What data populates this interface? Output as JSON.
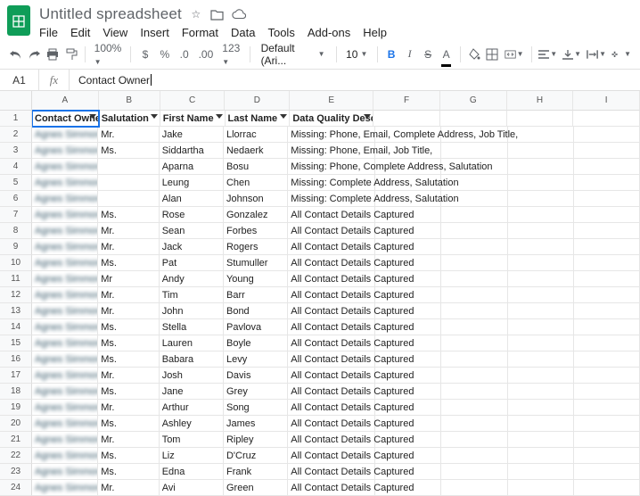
{
  "doc": {
    "title": "Untitled spreadsheet"
  },
  "menus": [
    "File",
    "Edit",
    "View",
    "Insert",
    "Format",
    "Data",
    "Tools",
    "Add-ons",
    "Help"
  ],
  "toolbar": {
    "zoom": "100%",
    "currency": "$",
    "percent": "%",
    "dec_dec": ".0",
    "dec_inc": ".00",
    "more_fmt": "123",
    "font": "Default (Ari...",
    "size": "10",
    "bold": "B",
    "italic": "I",
    "strike": "S",
    "textcolor": "A"
  },
  "fbar": {
    "cellref": "A1",
    "fx": "fx",
    "value": "Contact Owner"
  },
  "columns": [
    "A",
    "B",
    "C",
    "D",
    "E",
    "F",
    "G",
    "H",
    "I"
  ],
  "headers": {
    "A": "Contact Owner",
    "B": "Salutation",
    "C": "First Name",
    "D": "Last Name",
    "E": "Data Quality Description"
  },
  "rows": [
    {
      "n": 2,
      "owner": "Agnes Simmons",
      "sal": "Mr.",
      "first": "Jake",
      "last": "Llorrac",
      "dq": "Missing: Phone, Email, Complete Address, Job Title,"
    },
    {
      "n": 3,
      "owner": "Agnes Simmons",
      "sal": "Ms.",
      "first": "Siddartha",
      "last": "Nedaerk",
      "dq": "Missing: Phone, Email, Job Title,"
    },
    {
      "n": 4,
      "owner": "Agnes Simmons",
      "sal": "",
      "first": "Aparna",
      "last": "Bosu",
      "dq": "Missing: Phone, Complete Address, Salutation"
    },
    {
      "n": 5,
      "owner": "Agnes Simmons",
      "sal": "",
      "first": "Leung",
      "last": "Chen",
      "dq": "Missing: Complete Address, Salutation"
    },
    {
      "n": 6,
      "owner": "Agnes Simmons",
      "sal": "",
      "first": "Alan",
      "last": "Johnson",
      "dq": "Missing: Complete Address, Salutation"
    },
    {
      "n": 7,
      "owner": "Agnes Simmons",
      "sal": "Ms.",
      "first": "Rose",
      "last": "Gonzalez",
      "dq": "All Contact Details Captured"
    },
    {
      "n": 8,
      "owner": "Agnes Simmons",
      "sal": "Mr.",
      "first": "Sean",
      "last": "Forbes",
      "dq": "All Contact Details Captured"
    },
    {
      "n": 9,
      "owner": "Agnes Simmons",
      "sal": "Mr.",
      "first": "Jack",
      "last": "Rogers",
      "dq": "All Contact Details Captured"
    },
    {
      "n": 10,
      "owner": "Agnes Simmons",
      "sal": "Ms.",
      "first": "Pat",
      "last": "Stumuller",
      "dq": "All Contact Details Captured"
    },
    {
      "n": 11,
      "owner": "Agnes Simmons",
      "sal": "Mr",
      "first": "Andy",
      "last": "Young",
      "dq": "All Contact Details Captured"
    },
    {
      "n": 12,
      "owner": "Agnes Simmons",
      "sal": "Mr.",
      "first": "Tim",
      "last": "Barr",
      "dq": "All Contact Details Captured"
    },
    {
      "n": 13,
      "owner": "Agnes Simmons",
      "sal": "Mr.",
      "first": "John",
      "last": "Bond",
      "dq": "All Contact Details Captured"
    },
    {
      "n": 14,
      "owner": "Agnes Simmons",
      "sal": "Ms.",
      "first": "Stella",
      "last": "Pavlova",
      "dq": "All Contact Details Captured"
    },
    {
      "n": 15,
      "owner": "Agnes Simmons",
      "sal": "Ms.",
      "first": "Lauren",
      "last": "Boyle",
      "dq": "All Contact Details Captured"
    },
    {
      "n": 16,
      "owner": "Agnes Simmons",
      "sal": "Ms.",
      "first": "Babara",
      "last": "Levy",
      "dq": "All Contact Details Captured"
    },
    {
      "n": 17,
      "owner": "Agnes Simmons",
      "sal": "Mr.",
      "first": "Josh",
      "last": "Davis",
      "dq": "All Contact Details Captured"
    },
    {
      "n": 18,
      "owner": "Agnes Simmons",
      "sal": "Ms.",
      "first": "Jane",
      "last": "Grey",
      "dq": "All Contact Details Captured"
    },
    {
      "n": 19,
      "owner": "Agnes Simmons",
      "sal": "Mr.",
      "first": "Arthur",
      "last": "Song",
      "dq": "All Contact Details Captured"
    },
    {
      "n": 20,
      "owner": "Agnes Simmons",
      "sal": "Ms.",
      "first": "Ashley",
      "last": "James",
      "dq": "All Contact Details Captured"
    },
    {
      "n": 21,
      "owner": "Agnes Simmons",
      "sal": "Mr.",
      "first": "Tom",
      "last": "Ripley",
      "dq": "All Contact Details Captured"
    },
    {
      "n": 22,
      "owner": "Agnes Simmons",
      "sal": "Ms.",
      "first": "Liz",
      "last": "D'Cruz",
      "dq": "All Contact Details Captured"
    },
    {
      "n": 23,
      "owner": "Agnes Simmons",
      "sal": "Ms.",
      "first": "Edna",
      "last": "Frank",
      "dq": "All Contact Details Captured"
    },
    {
      "n": 24,
      "owner": "Agnes Simmons",
      "sal": "Mr.",
      "first": "Avi",
      "last": "Green",
      "dq": "All Contact Details Captured"
    }
  ]
}
